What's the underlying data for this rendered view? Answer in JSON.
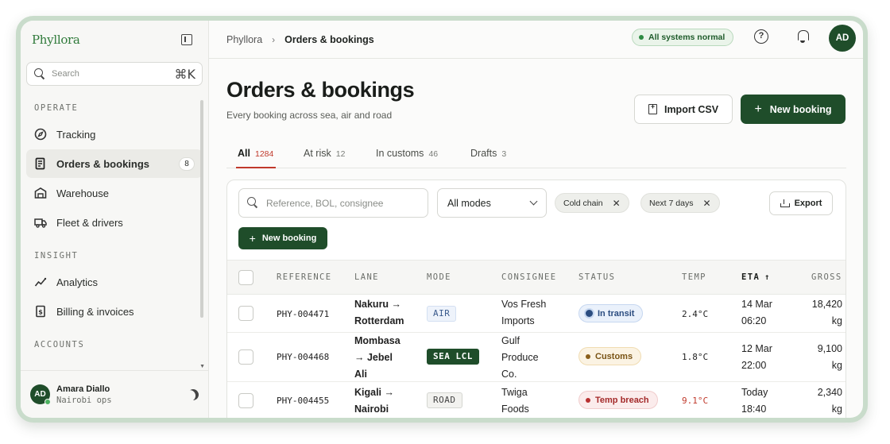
{
  "app": {
    "logo": "Phyllora"
  },
  "sidebar": {
    "search_placeholder": "Search",
    "search_shortcut": "⌘K",
    "sections": [
      {
        "label": "OPERATE"
      },
      {
        "label": "INSIGHT"
      },
      {
        "label": "ACCOUNTS"
      }
    ],
    "items": [
      {
        "label": "Tracking",
        "icon": "compass-icon"
      },
      {
        "label": "Orders & bookings",
        "icon": "document-list-icon",
        "badge": "8",
        "active": true
      },
      {
        "label": "Warehouse",
        "icon": "warehouse-icon"
      },
      {
        "label": "Fleet & drivers",
        "icon": "truck-icon"
      },
      {
        "label": "Analytics",
        "icon": "sparkline-icon"
      },
      {
        "label": "Billing & invoices",
        "icon": "invoice-icon"
      }
    ],
    "user": {
      "initials": "AD",
      "name": "Amara Diallo",
      "role": "Nairobi ops"
    }
  },
  "topbar": {
    "breadcrumb_root": "Phyllora",
    "breadcrumb_current": "Orders & bookings",
    "system_status": "All systems normal",
    "avatar_initials": "AD"
  },
  "header": {
    "title": "Orders & bookings",
    "subtitle": "Every booking across sea, air and road",
    "import_label": "Import CSV",
    "new_booking_label": "New booking"
  },
  "tabs": [
    {
      "label": "All",
      "count": "1284",
      "active": true
    },
    {
      "label": "At risk",
      "count": "12"
    },
    {
      "label": "In customs",
      "count": "46"
    },
    {
      "label": "Drafts",
      "count": "3"
    }
  ],
  "filters": {
    "search_placeholder": "Reference, BOL, consignee",
    "mode_selected": "All modes",
    "chips": [
      "Cold chain",
      "Next 7 days"
    ],
    "export_label": "Export",
    "new_booking_label": "New booking"
  },
  "table": {
    "columns": [
      "REFERENCE",
      "LANE",
      "MODE",
      "CONSIGNEE",
      "STATUS",
      "TEMP",
      "ETA",
      "GROSS"
    ],
    "sorted_column": "ETA",
    "rows": [
      {
        "reference": "PHY-004471",
        "lane": [
          "Nakuru →",
          "Rotterdam"
        ],
        "mode": "AIR",
        "consignee": [
          "Vos Fresh",
          "Imports"
        ],
        "status": "In transit",
        "temp": "2.4°C",
        "eta": [
          "14 Mar",
          "06:20"
        ],
        "gross": [
          "18,420",
          "kg"
        ]
      },
      {
        "reference": "PHY-004468",
        "lane": [
          "Mombasa",
          "→ Jebel",
          "Ali"
        ],
        "mode": "SEA LCL",
        "consignee": [
          "Gulf",
          "Produce",
          "Co."
        ],
        "status": "Customs",
        "temp": "1.8°C",
        "eta": [
          "12 Mar",
          "22:00"
        ],
        "gross": [
          "9,100",
          "kg"
        ]
      },
      {
        "reference": "PHY-004455",
        "lane": [
          "Kigali →",
          "Nairobi"
        ],
        "mode": "ROAD",
        "consignee": [
          "Twiga",
          "Foods"
        ],
        "status": "Temp breach",
        "temp": "9.1°C",
        "eta": [
          "Today",
          "18:40"
        ],
        "gross": [
          "2,340",
          "kg"
        ]
      }
    ]
  }
}
